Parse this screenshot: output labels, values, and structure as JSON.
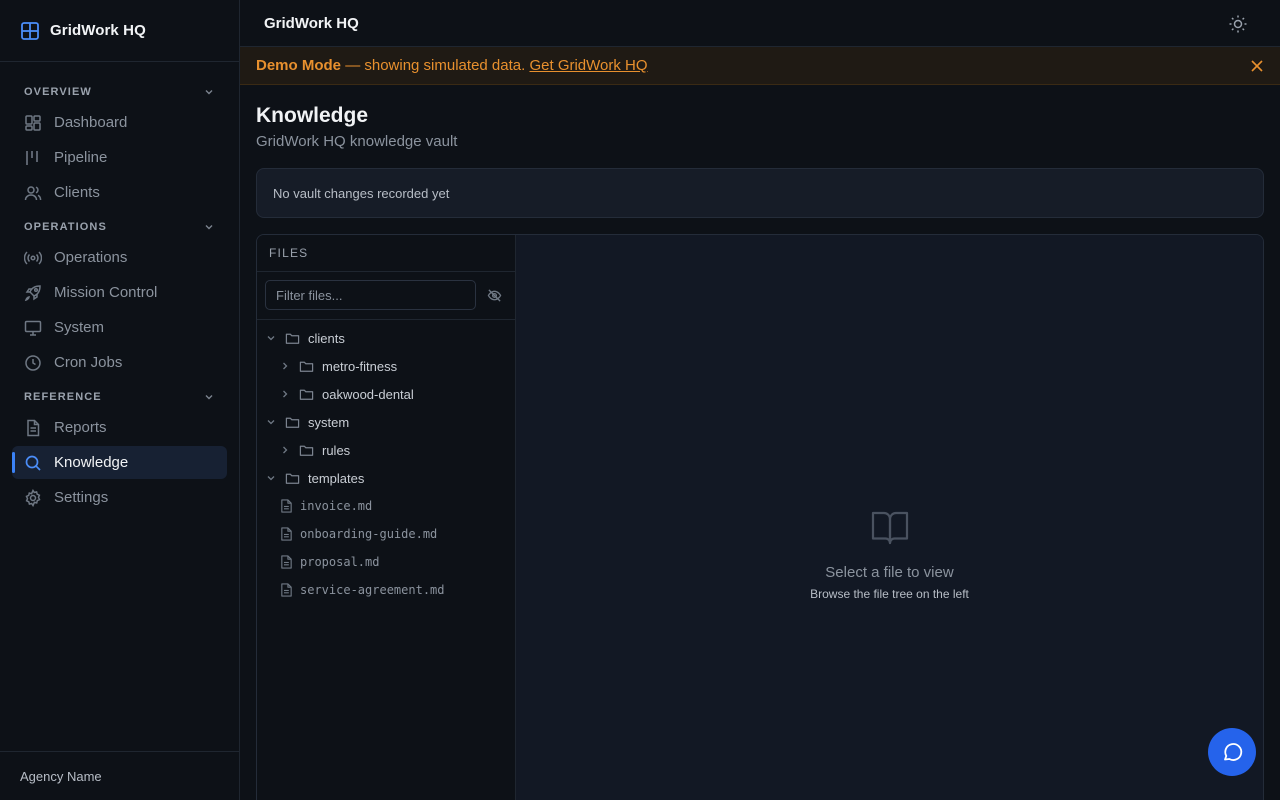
{
  "brand": {
    "name": "GridWork HQ",
    "icon": "grid-icon"
  },
  "topbar": {
    "title": "GridWork HQ",
    "theme_icon": "sun-icon"
  },
  "sidebar": {
    "sections": [
      {
        "title": "OVERVIEW",
        "items": [
          {
            "label": "Dashboard",
            "icon": "dashboard-icon"
          },
          {
            "label": "Pipeline",
            "icon": "pipeline-icon"
          },
          {
            "label": "Clients",
            "icon": "users-icon"
          }
        ]
      },
      {
        "title": "OPERATIONS",
        "items": [
          {
            "label": "Operations",
            "icon": "broadcast-icon"
          },
          {
            "label": "Mission Control",
            "icon": "rocket-icon"
          },
          {
            "label": "System",
            "icon": "monitor-icon"
          },
          {
            "label": "Cron Jobs",
            "icon": "clock-icon"
          }
        ]
      },
      {
        "title": "REFERENCE",
        "items": [
          {
            "label": "Reports",
            "icon": "document-icon"
          },
          {
            "label": "Knowledge",
            "icon": "search-icon",
            "active": true
          },
          {
            "label": "Settings",
            "icon": "gear-icon"
          }
        ]
      }
    ],
    "footer": "Agency Name"
  },
  "banner": {
    "mode": "Demo Mode",
    "message": "— showing simulated data.",
    "link": "Get GridWork HQ",
    "close_icon": "close-icon"
  },
  "page": {
    "title": "Knowledge",
    "subtitle": "GridWork HQ knowledge vault",
    "notice": "No vault changes recorded yet"
  },
  "files": {
    "heading": "FILES",
    "filter_placeholder": "Filter files...",
    "tree": [
      {
        "label": "clients",
        "type": "folder",
        "depth": 0,
        "expanded": true
      },
      {
        "label": "metro-fitness",
        "type": "folder",
        "depth": 1,
        "expanded": false
      },
      {
        "label": "oakwood-dental",
        "type": "folder",
        "depth": 1,
        "expanded": false
      },
      {
        "label": "system",
        "type": "folder",
        "depth": 0,
        "expanded": true
      },
      {
        "label": "rules",
        "type": "folder",
        "depth": 1,
        "expanded": false
      },
      {
        "label": "templates",
        "type": "folder",
        "depth": 0,
        "expanded": true
      },
      {
        "label": "invoice.md",
        "type": "file",
        "depth": 1
      },
      {
        "label": "onboarding-guide.md",
        "type": "file",
        "depth": 1
      },
      {
        "label": "proposal.md",
        "type": "file",
        "depth": 1
      },
      {
        "label": "service-agreement.md",
        "type": "file",
        "depth": 1
      }
    ]
  },
  "viewer": {
    "empty_title": "Select a file to view",
    "empty_subtitle": "Browse the file tree on the left",
    "empty_icon": "book-open-icon"
  },
  "chat": {
    "icon": "chat-bubble-icon"
  },
  "colors": {
    "accent": "#3b82f6",
    "banner_text": "#e8902e",
    "background": "#0d1117"
  }
}
